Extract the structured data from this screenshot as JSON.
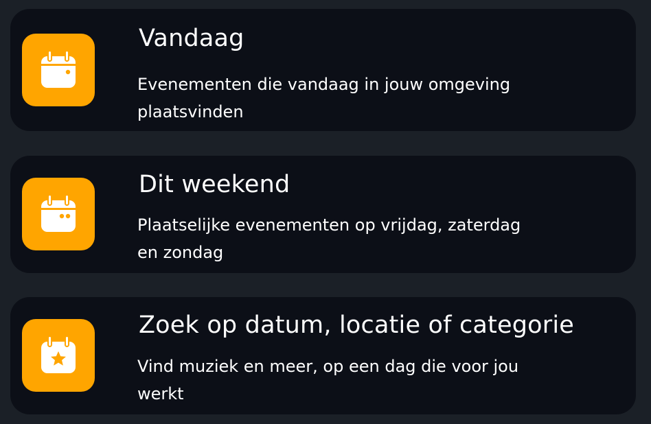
{
  "colors": {
    "page_background": "#1b2027",
    "card_background": "#0c0f17",
    "accent": "#ffa500",
    "text": "#ffffff"
  },
  "options": [
    {
      "icon": "calendar-today-icon",
      "title": "Vandaag",
      "description": "Evenementen die vandaag in jouw omgeving plaatsvinden"
    },
    {
      "icon": "calendar-weekend-icon",
      "title": "Dit weekend",
      "description": "Plaatselijke evenementen op vrijdag, zaterdag en zondag"
    },
    {
      "icon": "calendar-star-icon",
      "title": "Zoek op datum, locatie of categorie",
      "description": "Vind muziek en meer, op een dag die voor jou werkt"
    }
  ]
}
